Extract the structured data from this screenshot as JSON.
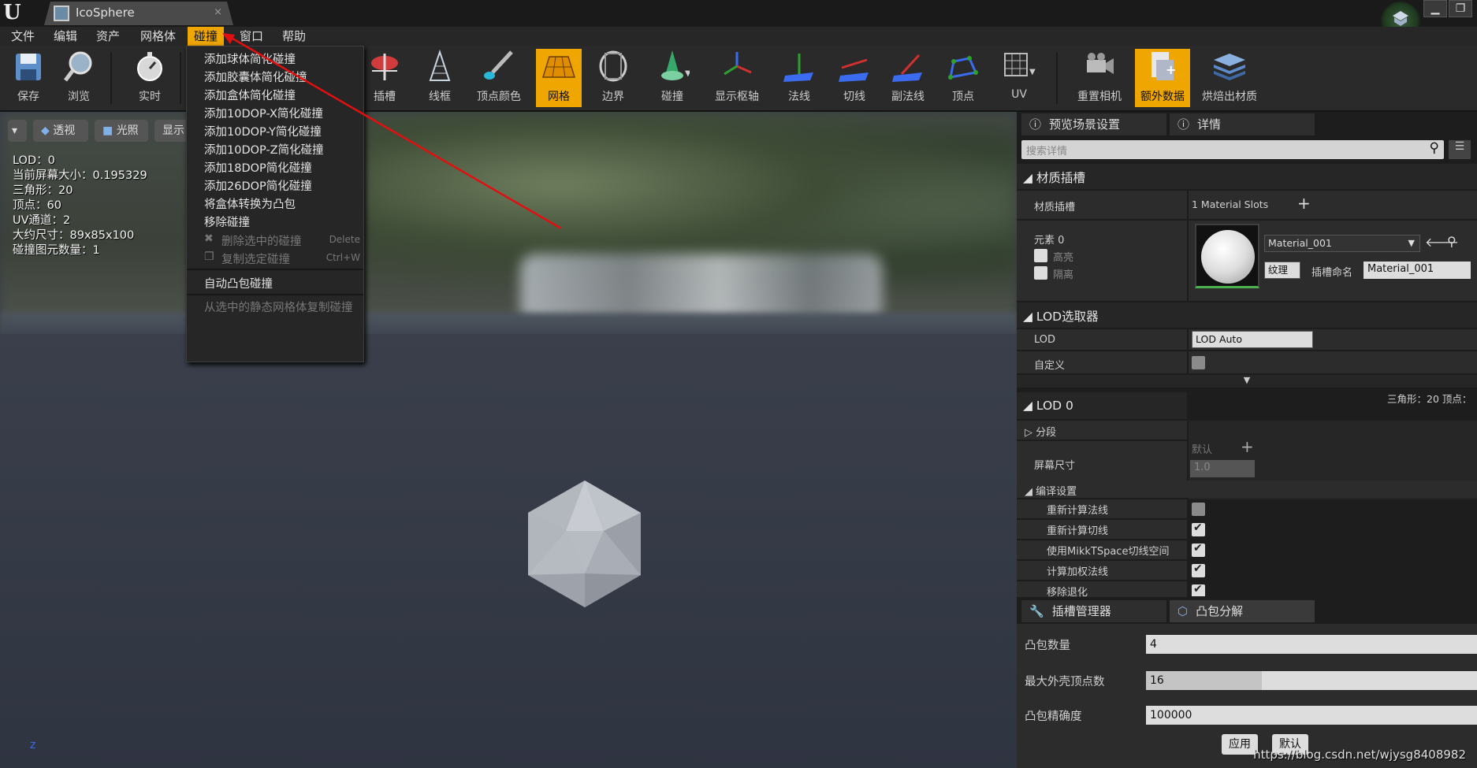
{
  "window": {
    "tab_title": "IcoSphere",
    "tab_close": "×",
    "min": "▁",
    "restore": "❐"
  },
  "menu": [
    "文件",
    "编辑",
    "资产",
    "网格体",
    "碰撞",
    "窗口",
    "帮助"
  ],
  "toolbar": {
    "save": "保存",
    "browse": "浏览",
    "realtime": "实时",
    "sockets": "插槽",
    "wireframe": "线框",
    "vertex_colors": "顶点颜色",
    "grid": "网格",
    "bounds": "边界",
    "collision": "碰撞",
    "show_pivot": "显示枢轴",
    "normals": "法线",
    "tangents": "切线",
    "binormals": "副法线",
    "vertices": "顶点",
    "uv": "UV",
    "reset_camera": "重置相机",
    "additional_data": "额外数据",
    "bake_material": "烘焙出材质"
  },
  "collision_menu": [
    {
      "label": "添加球体简化碰撞",
      "shortcut": "",
      "disabled": false
    },
    {
      "label": "添加胶囊体简化碰撞",
      "shortcut": "",
      "disabled": false
    },
    {
      "label": "添加盒体简化碰撞",
      "shortcut": "",
      "disabled": false
    },
    {
      "label": "添加10DOP-X简化碰撞",
      "shortcut": "",
      "disabled": false
    },
    {
      "label": "添加10DOP-Y简化碰撞",
      "shortcut": "",
      "disabled": false
    },
    {
      "label": "添加10DOP-Z简化碰撞",
      "shortcut": "",
      "disabled": false
    },
    {
      "label": "添加18DOP简化碰撞",
      "shortcut": "",
      "disabled": false
    },
    {
      "label": "添加26DOP简化碰撞",
      "shortcut": "",
      "disabled": false
    },
    {
      "label": "将盒体转换为凸包",
      "shortcut": "",
      "disabled": false
    },
    {
      "label": "移除碰撞",
      "shortcut": "",
      "disabled": false
    },
    {
      "label": "删除选中的碰撞",
      "shortcut": "Delete",
      "disabled": true
    },
    {
      "label": "复制选定碰撞",
      "shortcut": "Ctrl+W",
      "disabled": true
    },
    {
      "label": "自动凸包碰撞",
      "shortcut": "",
      "disabled": false
    },
    {
      "label": "从选中的静态网格体复制碰撞",
      "shortcut": "",
      "disabled": true
    }
  ],
  "viewport": {
    "perspective": "透视",
    "lit": "光照",
    "show": "显示"
  },
  "stats": [
    "LOD：0",
    "当前屏幕大小：0.195329",
    "三角形：20",
    "顶点：60",
    "UV通道：2",
    "大约尺寸：89x85x100",
    "碰撞图元数量：1"
  ],
  "details": {
    "tab_preview": "预览场景设置",
    "tab_details": "详情",
    "search_placeholder": "搜索详情",
    "material_slots_section": "材质插槽",
    "material_slots_label": "材质插槽",
    "material_slots_count": "1 Material Slots",
    "element0": "元素 0",
    "highlight": "高亮",
    "isolate": "隔离",
    "material_name": "Material_001",
    "texture_btn": "纹理",
    "slot_name_label": "插槽命名",
    "slot_name_value": "Material_001",
    "lod_picker_section": "LOD选取器",
    "lod_label": "LOD",
    "lod_value": "LOD Auto",
    "custom_label": "自定义",
    "lod0_stats": "三角形：20   顶点：",
    "lod0_section": "LOD 0",
    "sections_label": "分段",
    "default_label": "默认",
    "screen_size_label": "屏幕尺寸",
    "screen_size_value": "1.0",
    "build_settings": "编译设置",
    "recompute_normals": "重新计算法线",
    "recompute_tangents": "重新计算切线",
    "use_mikkt": "使用MikkTSpace切线空间",
    "compute_weighted": "计算加权法线",
    "remove_degenerates": "移除退化"
  },
  "convex": {
    "tab_sockets": "插槽管理器",
    "tab_convex": "凸包分解",
    "hull_count_label": "凸包数量",
    "hull_count": "4",
    "max_verts_label": "最大外壳顶点数",
    "max_verts": "16",
    "precision_label": "凸包精确度",
    "precision": "100000",
    "apply": "应用",
    "default": "默认"
  },
  "watermark": "https://blog.csdn.net/wjysg8408982",
  "colors": {
    "accent": "#f0a600",
    "annotation_arrow": "#e01010"
  }
}
